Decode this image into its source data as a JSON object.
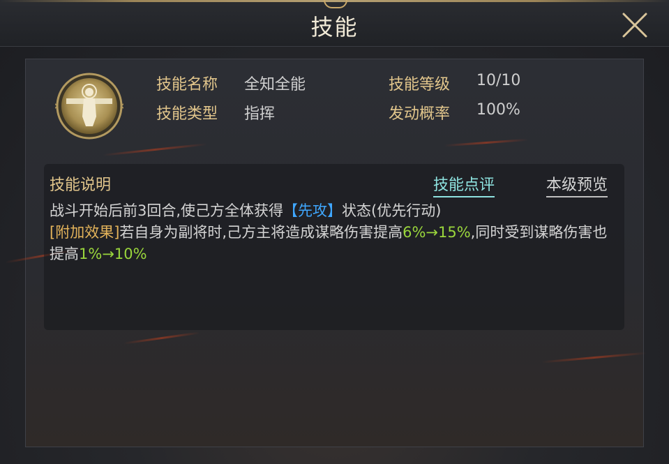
{
  "header": {
    "title": "技能",
    "close_icon": "close-icon"
  },
  "skill": {
    "icon": "saint-medal-icon",
    "name_label": "技能名称",
    "name": "全知全能",
    "level_label": "技能等级",
    "level": "10/10",
    "type_label": "技能类型",
    "type": "指挥",
    "rate_label": "发动概率",
    "rate": "100%"
  },
  "description": {
    "title": "技能说明",
    "tabs": {
      "review": "技能点评",
      "preview": "本级预览"
    },
    "line1_prefix": "战斗开始后前3回合,使己方全体获得",
    "line1_keyword": "【先攻】",
    "line1_suffix": "状态(优先行动)",
    "bonus_label": "[附加效果]",
    "bonus_text1": "若自身为副将时,己方主将造成谋略伤害提高",
    "bonus_value1": "6%→15%",
    "bonus_text2": ",同时受到谋略伤害也提高",
    "bonus_value2": "1%→10%"
  },
  "colors": {
    "label_gold": "#e2c68c",
    "keyword_blue": "#3fa7ff",
    "bonus_gold": "#e3b35a",
    "value_green": "#9ad63c",
    "tab_cyan": "#8ee3e0"
  }
}
